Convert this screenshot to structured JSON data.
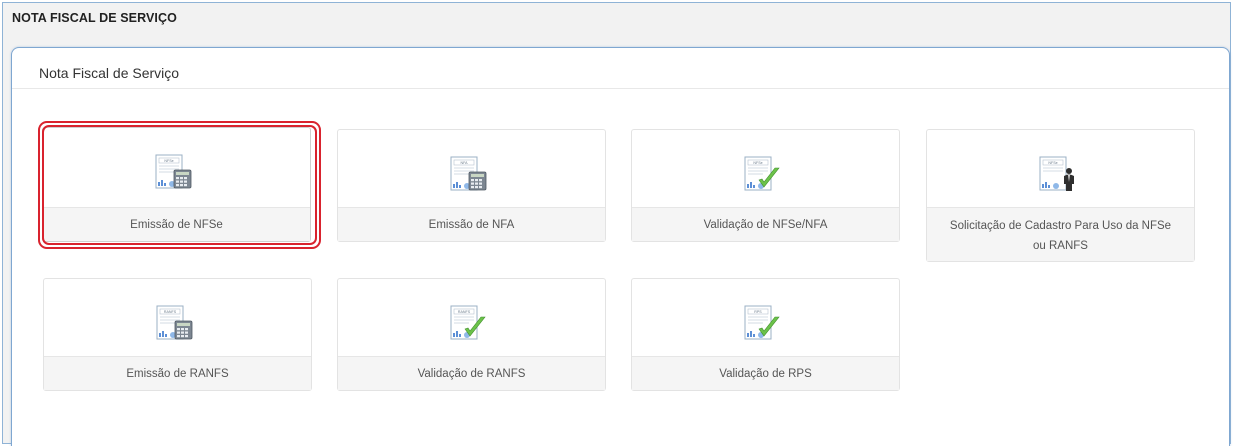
{
  "window": {
    "title": "NOTA FISCAL DE SERVIÇO"
  },
  "panel": {
    "title": "Nota Fiscal de Serviço"
  },
  "tiles": [
    {
      "label": "Emissão de NFSe",
      "badge": "NFSe",
      "icon": "calculator-icon",
      "selected": true
    },
    {
      "label": "Emissão de NFA",
      "badge": "NFA",
      "icon": "calculator-icon"
    },
    {
      "label": "Validação de NFSe/NFA",
      "badge": "NFSe",
      "icon": "checkmark-icon"
    },
    {
      "label": "Solicitação de Cadastro Para Uso da NFSe ou RANFS",
      "badge": "NFSe",
      "icon": "person-icon"
    },
    {
      "label": "Emissão de RANFS",
      "badge": "RANFS",
      "icon": "calculator-icon"
    },
    {
      "label": "Validação de RANFS",
      "badge": "RANFS",
      "icon": "checkmark-icon"
    },
    {
      "label": "Validação de RPS",
      "badge": "RPS",
      "icon": "checkmark-icon"
    }
  ],
  "colors": {
    "selection": "#d9232e",
    "panel_border": "#7fa7d1",
    "check": "#6cc24a"
  }
}
